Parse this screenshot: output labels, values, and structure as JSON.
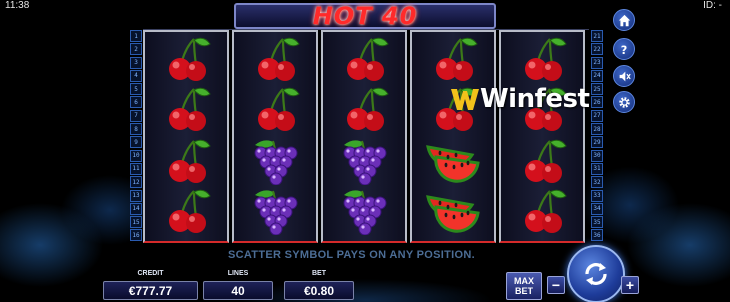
{
  "status": {
    "time": "11:38",
    "id_label": "ID: -"
  },
  "game": {
    "title": "HOT 40"
  },
  "paylines": {
    "left": [
      "1",
      "2",
      "3",
      "4",
      "5",
      "6",
      "7",
      "8",
      "9",
      "10",
      "11",
      "12",
      "13",
      "14",
      "15",
      "16"
    ],
    "right": [
      "21",
      "22",
      "23",
      "24",
      "25",
      "26",
      "27",
      "28",
      "29",
      "30",
      "31",
      "32",
      "33",
      "34",
      "35",
      "36"
    ]
  },
  "reels": [
    [
      "cherry",
      "cherry",
      "cherry",
      "cherry"
    ],
    [
      "cherry",
      "cherry",
      "grapes",
      "grapes"
    ],
    [
      "cherry",
      "cherry",
      "grapes",
      "grapes"
    ],
    [
      "cherry",
      "cherry",
      "watermelon",
      "watermelon"
    ],
    [
      "cherry",
      "cherry",
      "cherry",
      "cherry"
    ]
  ],
  "side_buttons": [
    "home-icon",
    "help-icon",
    "sound-off-icon",
    "settings-icon"
  ],
  "watermark": {
    "text": "Winfest"
  },
  "message": "SCATTER SYMBOL PAYS ON ANY POSITION.",
  "panel": {
    "credit_label": "CREDIT",
    "credit_value": "€777.77",
    "lines_label": "LINES",
    "lines_value": "40",
    "bet_label": "BET",
    "bet_value": "€0.80"
  },
  "controls": {
    "max_label": "MAX",
    "bet_label": "BET",
    "minus": "−",
    "plus": "+"
  },
  "colors": {
    "accent": "#ff2a2a",
    "panel": "#1e2258",
    "button": "#3d66c7"
  }
}
